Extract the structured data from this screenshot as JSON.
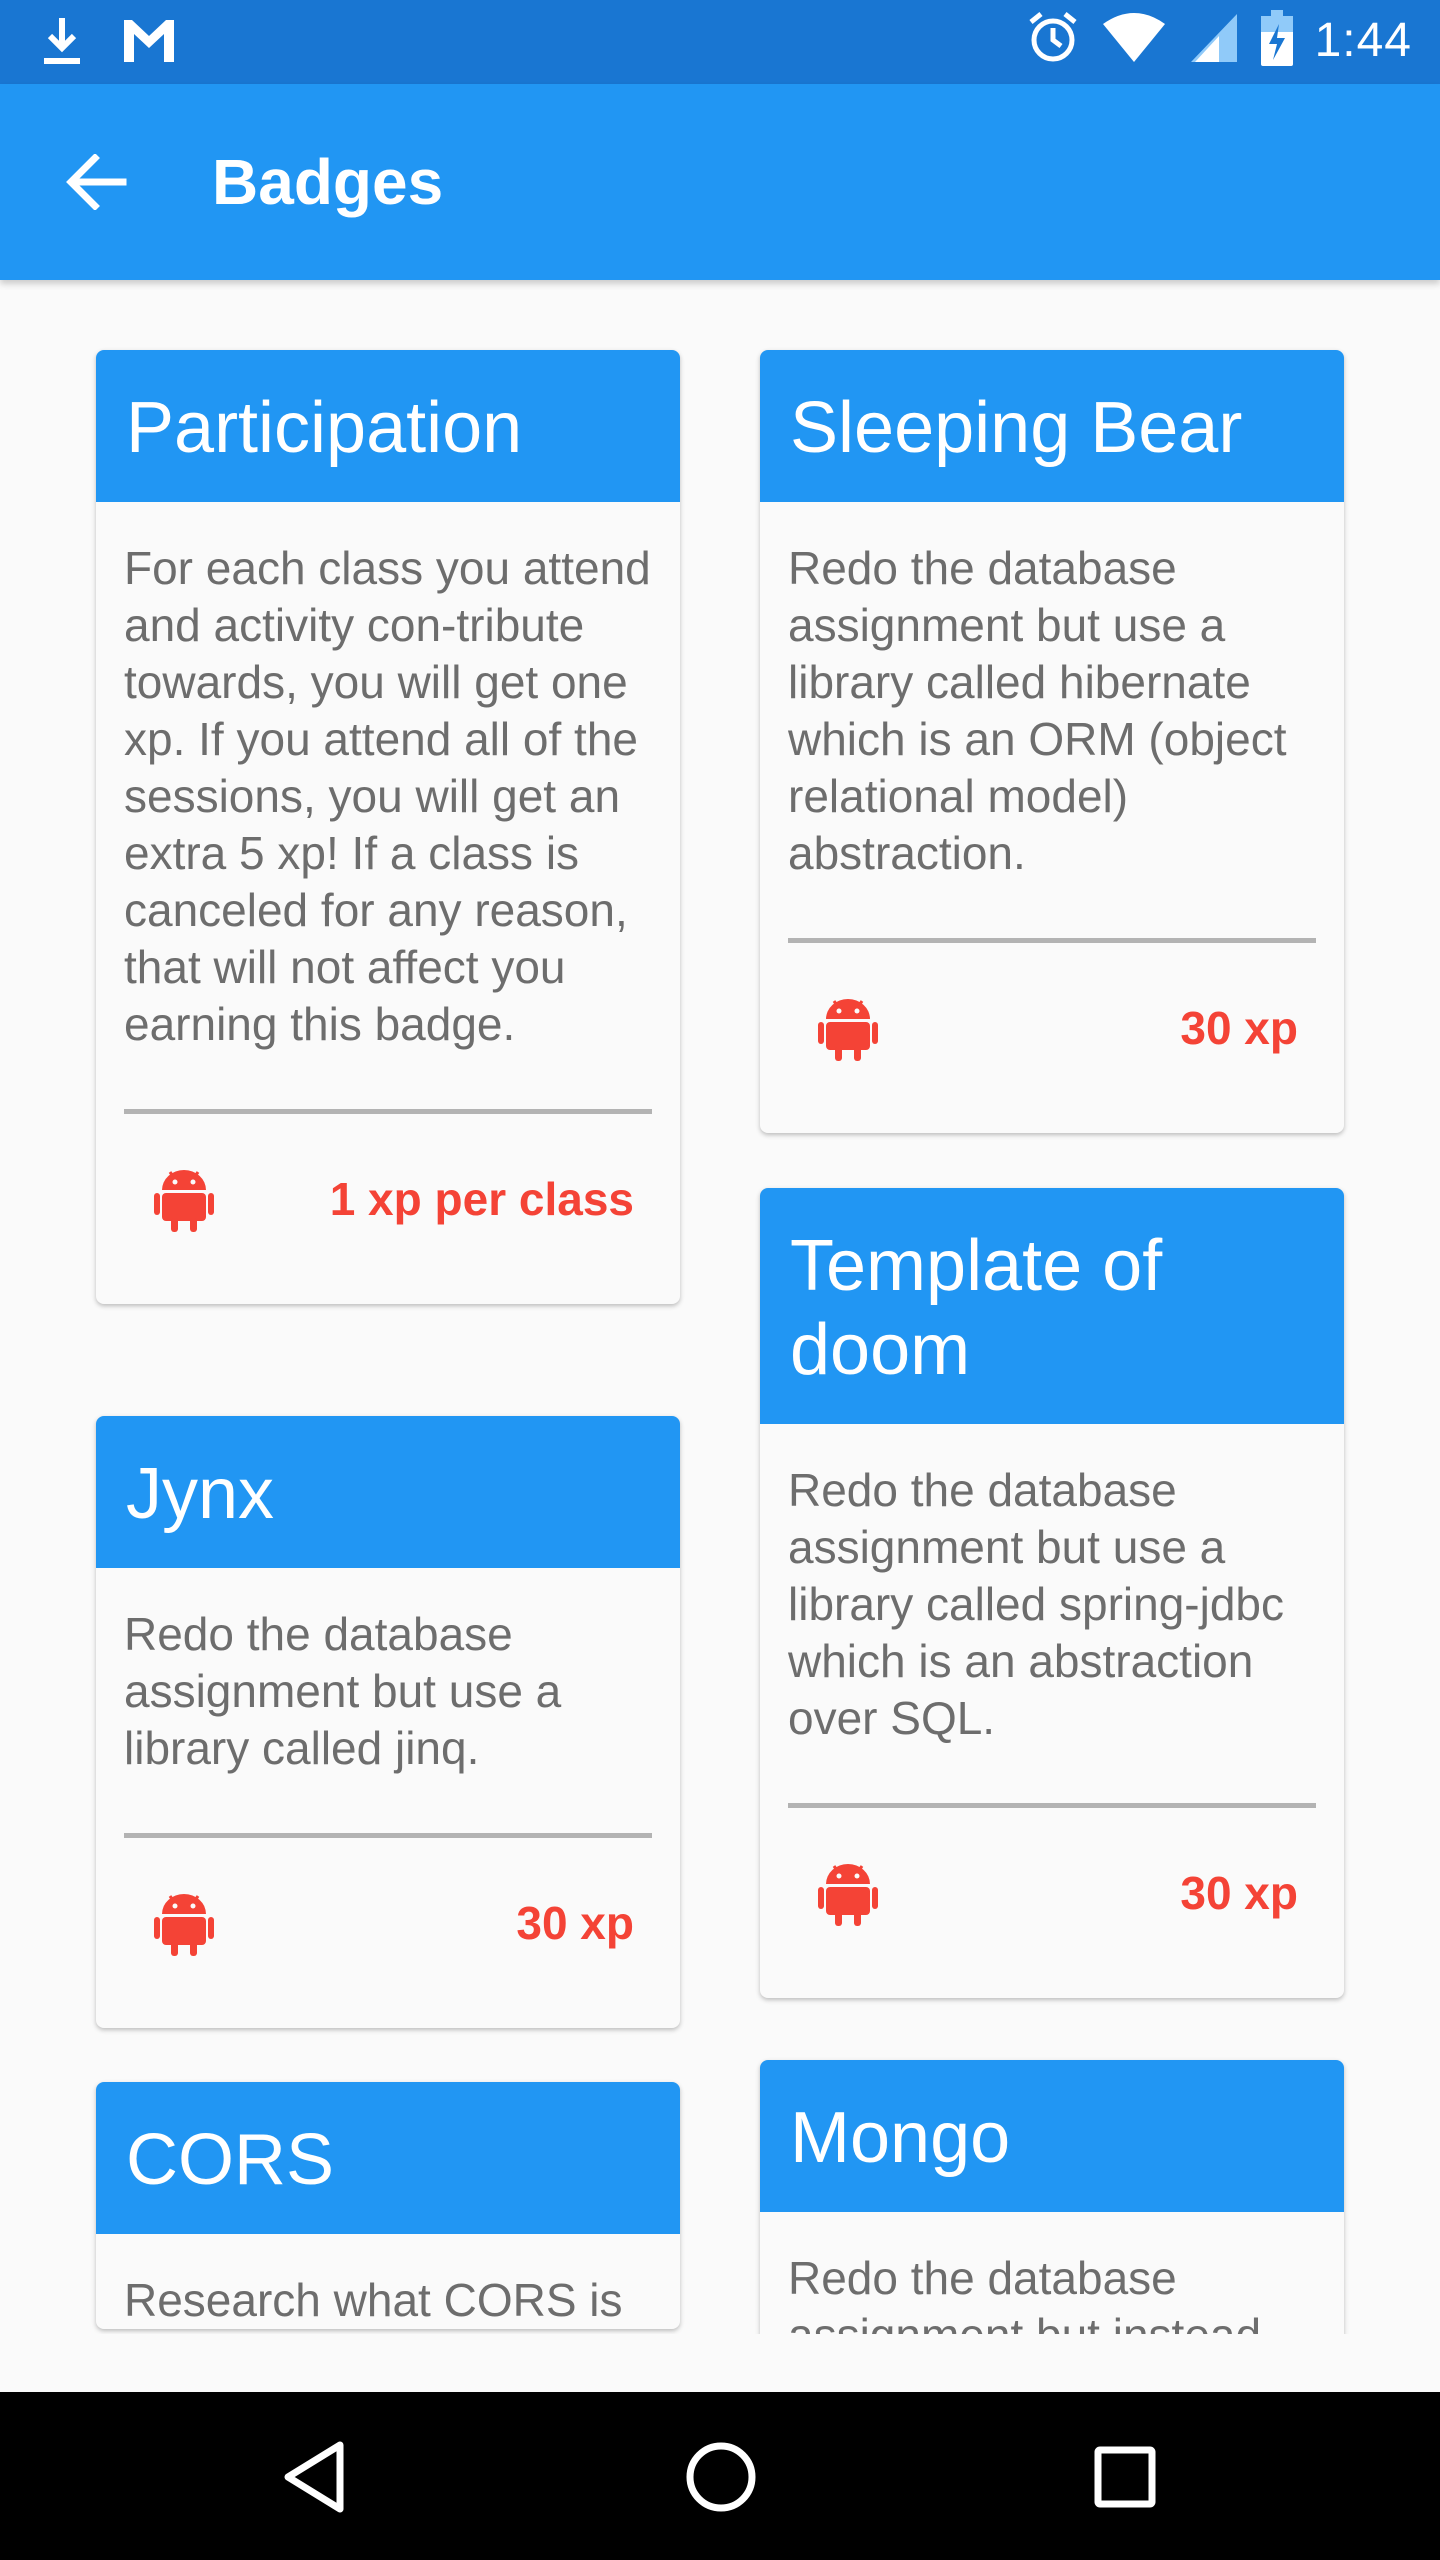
{
  "status_bar": {
    "time": "1:44",
    "icons": [
      "download-icon",
      "gmail-icon",
      "alarm-icon",
      "wifi-icon",
      "signal-icon",
      "battery-charging-icon"
    ]
  },
  "app_bar": {
    "title": "Badges",
    "back_icon": "arrow-back-icon"
  },
  "badges": [
    {
      "title": "Participation",
      "description": "For each class you attend and activity con-tribute towards, you will get one xp. If you attend all of the sessions, you will get an extra 5 xp! If a class is canceled for any reason, that will not affect you earning this badge.",
      "xp": "1 xp per class",
      "icon": "android-icon"
    },
    {
      "title": "Sleeping Bear",
      "description": "Redo the database assignment but use a library called hibernate which is an ORM (object relational model) abstraction.",
      "xp": "30 xp",
      "icon": "android-icon"
    },
    {
      "title": "Jynx",
      "description": "Redo the database assignment but use a library called jinq.",
      "xp": "30 xp",
      "icon": "android-icon"
    },
    {
      "title": "Template of doom",
      "description": "Redo the database assignment but use a library called spring-jdbc which is an abstraction over SQL.",
      "xp": "30 xp",
      "icon": "android-icon"
    },
    {
      "title": "CORS",
      "description": "Research what CORS is",
      "xp": "",
      "icon": "android-icon"
    },
    {
      "title": "Mongo",
      "description": "Redo the database assignment but instead",
      "xp": "",
      "icon": "android-icon"
    }
  ],
  "nav_bar": {
    "icons": [
      "back-triangle-icon",
      "home-circle-icon",
      "recents-square-icon"
    ]
  },
  "colors": {
    "status_bar": "#1976d2",
    "app_bar": "#2196f3",
    "card_header": "#2196f3",
    "xp_accent": "#f44336",
    "body_text": "#6d6d6d",
    "background": "#fafafa"
  }
}
